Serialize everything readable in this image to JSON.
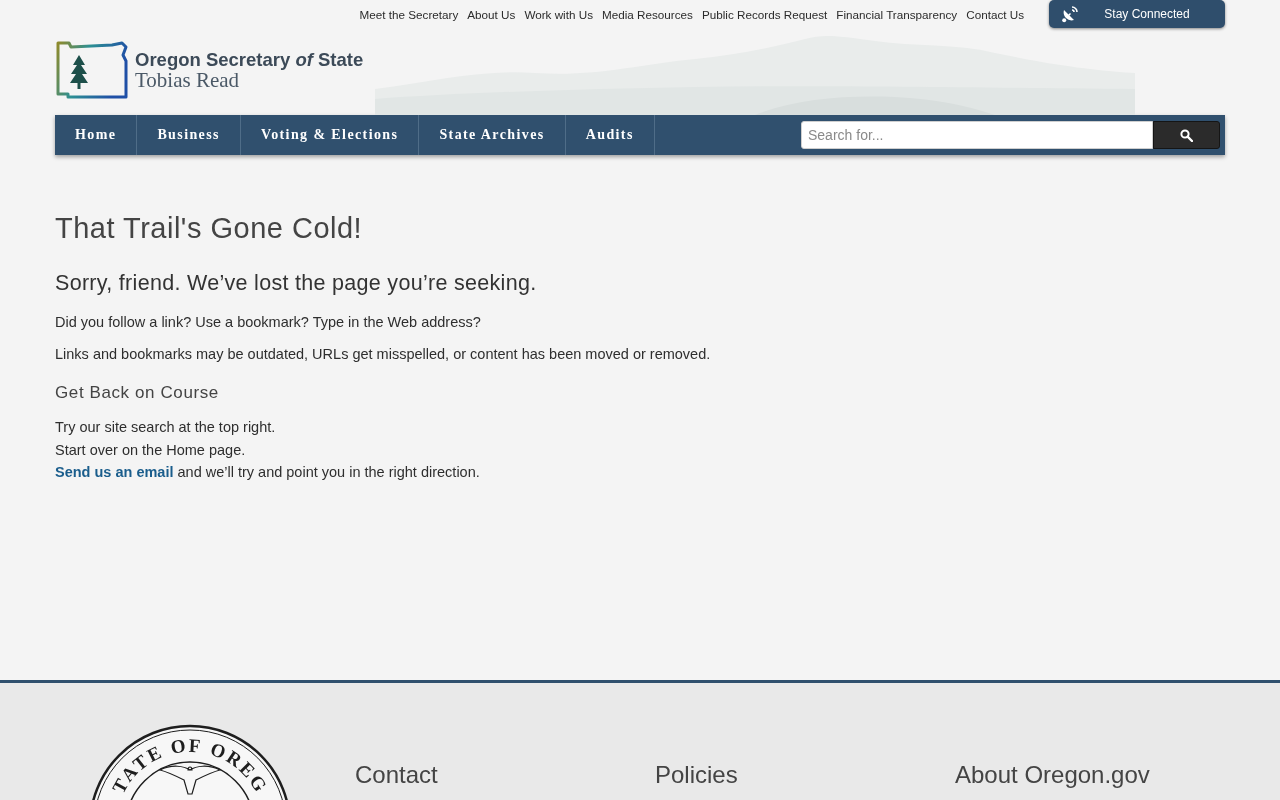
{
  "utility_links": [
    {
      "label": "Meet the Secretary"
    },
    {
      "label": "About Us"
    },
    {
      "label": "Work with Us"
    },
    {
      "label": "Media Resources"
    },
    {
      "label": "Public Records Request"
    },
    {
      "label": "Financial Transparency"
    },
    {
      "label": "Contact Us"
    }
  ],
  "stay_connected": {
    "label": "Stay Connected"
  },
  "logo": {
    "title": "Oregon Secretary *of* State",
    "subtitle": "Tobias Read"
  },
  "nav": [
    {
      "label": "Home"
    },
    {
      "label": "Business"
    },
    {
      "label": "Voting & Elections"
    },
    {
      "label": "State Archives"
    },
    {
      "label": "Audits"
    }
  ],
  "search": {
    "placeholder": "Search for..."
  },
  "content": {
    "title": "That Trail's Gone Cold!",
    "subtitle": "Sorry, friend. We’ve lost the page you’re seeking.",
    "paragraphs": [
      "Did you follow a link? Use a bookmark? Type in the Web address?",
      "Links and bookmarks may be outdated, URLs get misspelled, or content has been moved or removed."
    ],
    "section_heading": "Get Back on Course",
    "lines": [
      {
        "text": "Try our site search at the top right."
      },
      {
        "text": "Start over on the Home page."
      },
      {
        "link": "Send us an email",
        "text": "and we’ll try and point you in the right direction."
      }
    ]
  },
  "footer": {
    "seal_text": "TATE OF OREG",
    "headings": [
      "Contact",
      "Policies",
      "About Oregon.gov"
    ]
  }
}
